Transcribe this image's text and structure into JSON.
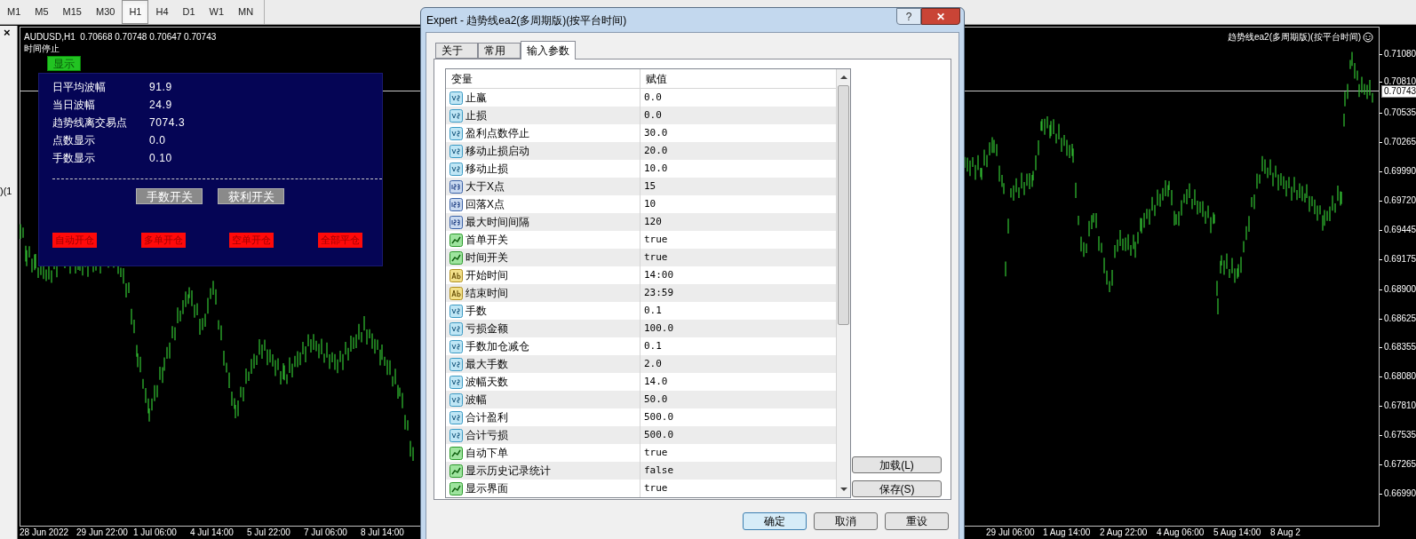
{
  "toolbar": {
    "periods": [
      {
        "label": "M1",
        "selected": false
      },
      {
        "label": "M5",
        "selected": false
      },
      {
        "label": "M15",
        "selected": false
      },
      {
        "label": "M30",
        "selected": false
      },
      {
        "label": "H1",
        "selected": true
      },
      {
        "label": "H4",
        "selected": false
      },
      {
        "label": "D1",
        "selected": false
      },
      {
        "label": "W1",
        "selected": false
      },
      {
        "label": "MN",
        "selected": false
      }
    ]
  },
  "gutter": {
    "close": "×",
    "cut_text": ")(1"
  },
  "chart": {
    "symbol_line": "AUDUSD,H1  0.70668 0.70748 0.70647 0.70743",
    "status": "时间停止",
    "expert_label": "趋势线ea2(多周期版)(按平台时间)",
    "current_price": "0.70743",
    "price_labels": [
      "0.71080",
      "0.70810",
      "0.70535",
      "0.70265",
      "0.69990",
      "0.69720",
      "0.69445",
      "0.69175",
      "0.68900",
      "0.68625",
      "0.68355",
      "0.68080",
      "0.67810",
      "0.67535",
      "0.67265",
      "0.66990"
    ],
    "time_labels_left": [
      "28 Jun 2022",
      "29 Jun 22:00",
      "1 Jul 06:00",
      "4 Jul 14:00",
      "5 Jul 22:00",
      "7 Jul 06:00",
      "8 Jul 14:00"
    ],
    "time_labels_right": [
      "29 Jul 06:00",
      "1 Aug 14:00",
      "2 Aug 22:00",
      "4 Aug 06:00",
      "5 Aug 14:00",
      "8 Aug 2"
    ]
  },
  "panel": {
    "toggle": "显示",
    "stats": [
      {
        "label": "日平均波幅",
        "value": "91.9"
      },
      {
        "label": "当日波幅",
        "value": "24.9"
      },
      {
        "label": "趋势线离交易点",
        "value": "7074.3"
      },
      {
        "label": "点数显示",
        "value": "0.0"
      },
      {
        "label": "手数显示",
        "value": "0.10"
      }
    ],
    "switches": [
      "手数开关",
      "获利开关"
    ],
    "actions": [
      "自动开仓",
      "多单开仓",
      "空单开仓",
      "全部平仓"
    ]
  },
  "dialog": {
    "title": "Expert - 趋势线ea2(多周期版)(按平台时间)",
    "help": "?",
    "close": "✕",
    "tabs": [
      {
        "label": "关于",
        "selected": false
      },
      {
        "label": "常用",
        "selected": false
      },
      {
        "label": "输入参数",
        "selected": true
      }
    ],
    "columns": [
      "变量",
      "赋值"
    ],
    "params": [
      {
        "kind": "double",
        "name": "止赢",
        "value": "0.0"
      },
      {
        "kind": "double",
        "name": "止损",
        "value": "0.0"
      },
      {
        "kind": "double",
        "name": "盈利点数停止",
        "value": "30.0"
      },
      {
        "kind": "double",
        "name": "移动止损启动",
        "value": "20.0"
      },
      {
        "kind": "double",
        "name": "移动止损",
        "value": "10.0"
      },
      {
        "kind": "int",
        "name": "大于X点",
        "value": "15"
      },
      {
        "kind": "int",
        "name": "回落X点",
        "value": "10"
      },
      {
        "kind": "int",
        "name": "最大时间间隔",
        "value": "120"
      },
      {
        "kind": "bool",
        "name": "首单开关",
        "value": "true"
      },
      {
        "kind": "bool",
        "name": "时间开关",
        "value": "true"
      },
      {
        "kind": "string",
        "name": "开始时间",
        "value": "14:00"
      },
      {
        "kind": "string",
        "name": "结束时间",
        "value": "23:59"
      },
      {
        "kind": "double",
        "name": "手数",
        "value": "0.1"
      },
      {
        "kind": "double",
        "name": "亏损金额",
        "value": "100.0"
      },
      {
        "kind": "double",
        "name": "手数加仓减仓",
        "value": "0.1"
      },
      {
        "kind": "double",
        "name": "最大手数",
        "value": "2.0"
      },
      {
        "kind": "double",
        "name": "波幅天数",
        "value": "14.0"
      },
      {
        "kind": "double",
        "name": "波幅",
        "value": "50.0"
      },
      {
        "kind": "double",
        "name": "合计盈利",
        "value": "500.0"
      },
      {
        "kind": "double",
        "name": "合计亏损",
        "value": "500.0"
      },
      {
        "kind": "bool",
        "name": "自动下单",
        "value": "true"
      },
      {
        "kind": "bool",
        "name": "显示历史记录统计",
        "value": "false"
      },
      {
        "kind": "bool",
        "name": "显示界面",
        "value": "true"
      }
    ],
    "side_buttons": [
      "加载(L)",
      "保存(S)"
    ],
    "buttons": [
      "确定",
      "取消",
      "重设"
    ]
  }
}
